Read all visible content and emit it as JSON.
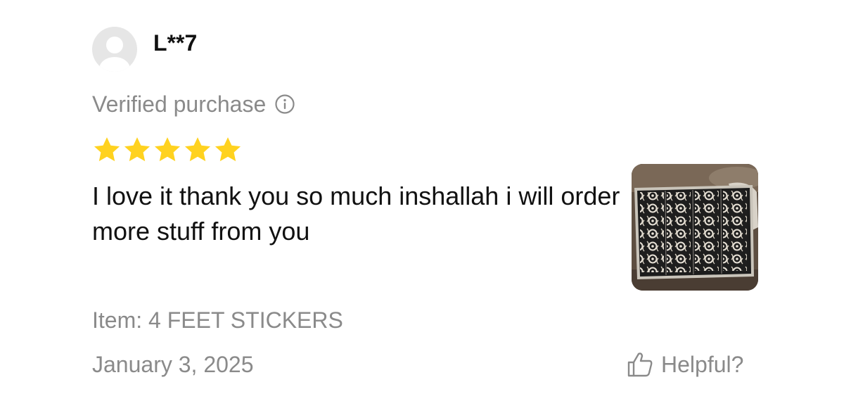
{
  "review": {
    "username": "L**7",
    "verified_label": "Verified purchase",
    "rating": 5,
    "rating_max": 5,
    "star_color": "#FFD21F",
    "text": "I love it thank you so much inshallah i will order more stuff from you",
    "item_label": "Item: 4 FEET STICKERS",
    "date": "January 3, 2025",
    "helpful_label": "Helpful?"
  },
  "icons": {
    "avatar": "default-user-avatar",
    "info": "info-circle-icon",
    "star": "star-filled-icon",
    "helpful": "thumbs-up-icon"
  },
  "colors": {
    "secondary_text": "#8a8a8a",
    "primary_text": "#111111",
    "avatar_bg": "#e6e6e6"
  }
}
